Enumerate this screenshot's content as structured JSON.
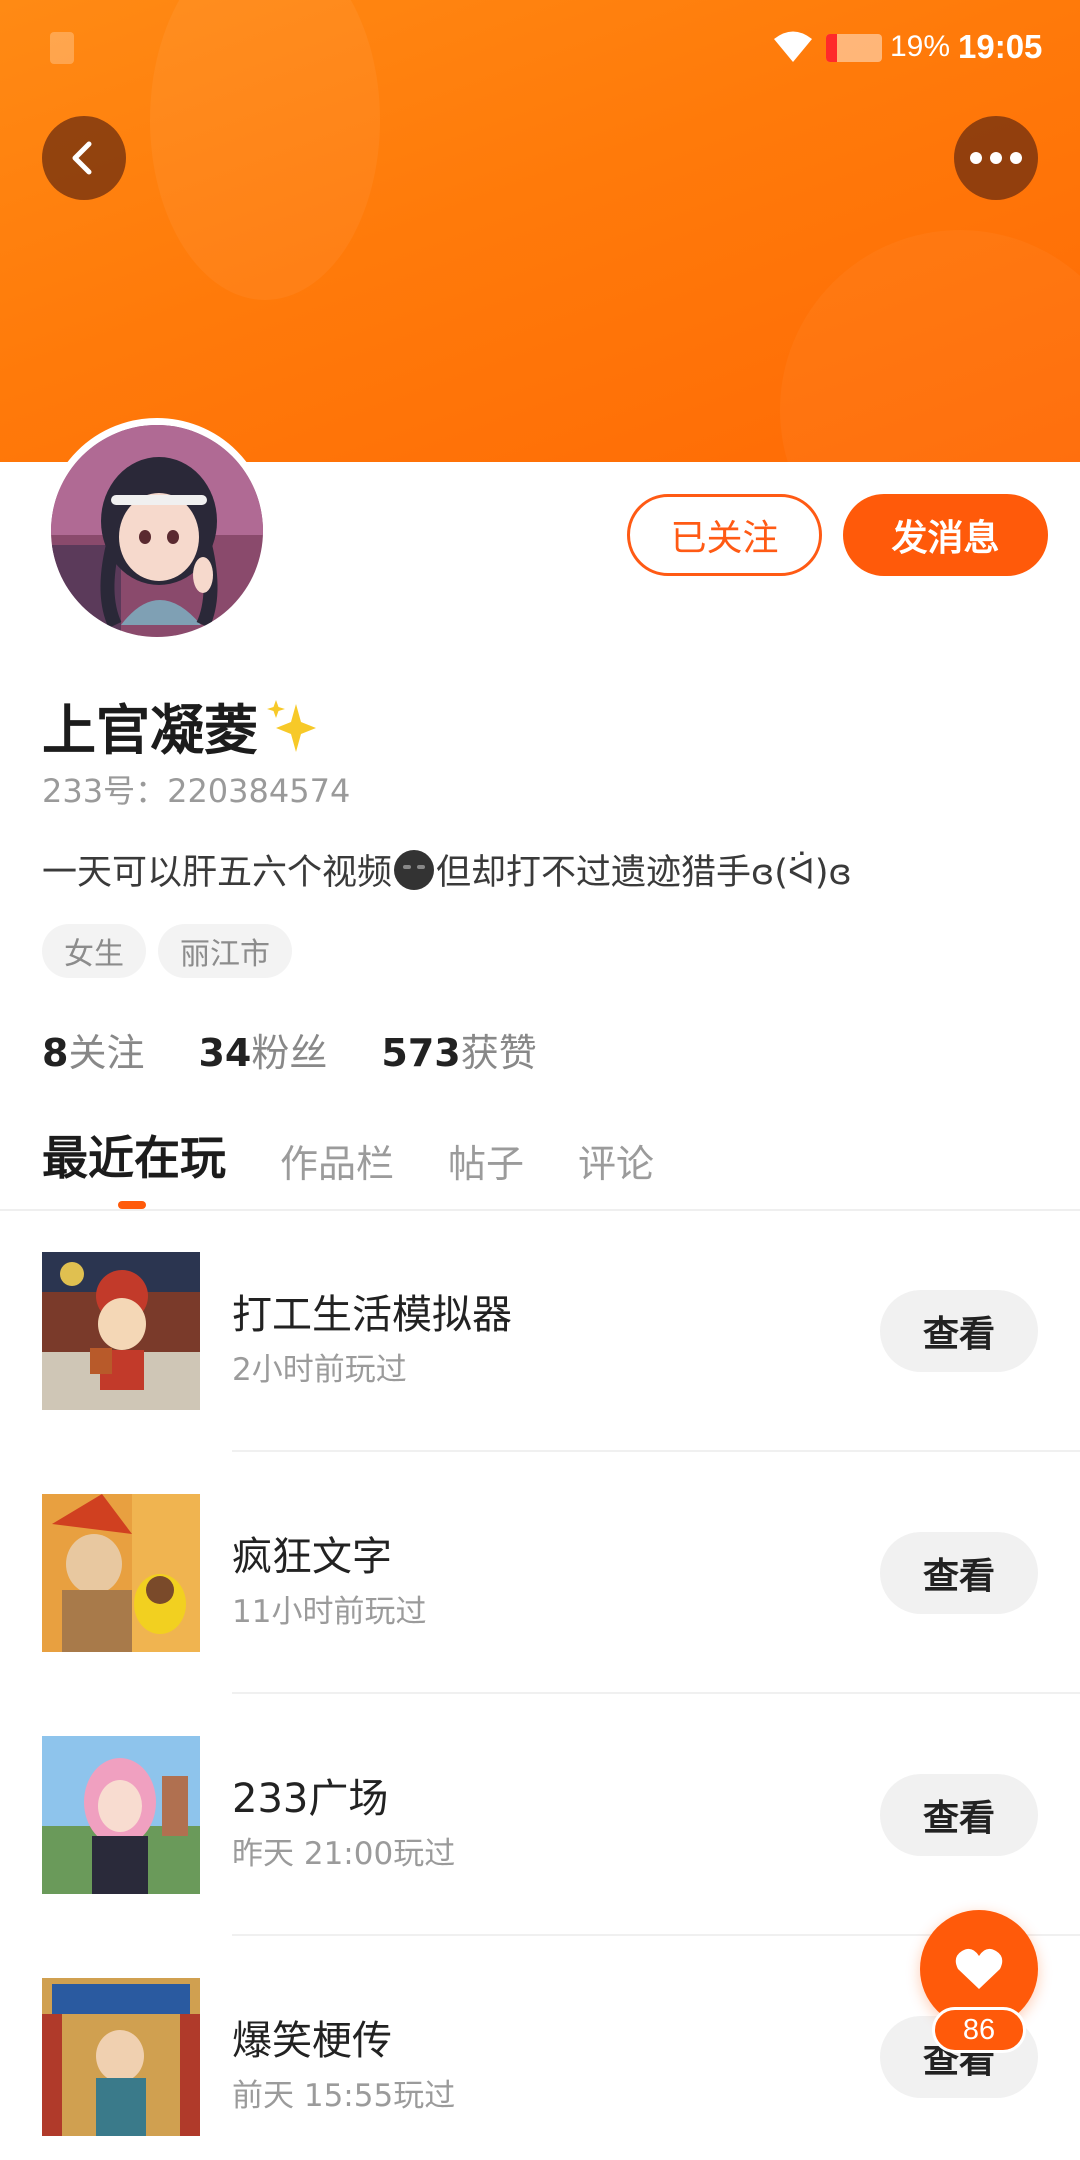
{
  "status_bar": {
    "battery_percent": "19%",
    "battery_level": 0.19,
    "time": "19:05"
  },
  "profile": {
    "name": "上官凝菱",
    "id_text": "233号：220384574",
    "bio_before": "一天可以肝五六个视频",
    "bio_after": "但却打不过遗迹猎手ɞ(ᐛ)ɞ",
    "tags": [
      "女生",
      "丽江市"
    ]
  },
  "actions": {
    "follow_label": "已关注",
    "message_label": "发消息"
  },
  "stats": {
    "following_count": "8",
    "following_label": "关注",
    "fans_count": "34",
    "fans_label": "粉丝",
    "likes_count": "573",
    "likes_label": "获赞"
  },
  "tabs": [
    "最近在玩",
    "作品栏",
    "帖子",
    "评论"
  ],
  "games": [
    {
      "title": "打工生活模拟器",
      "played": "2小时前玩过",
      "button": "查看"
    },
    {
      "title": "疯狂文字",
      "played": "11小时前玩过",
      "button": "查看"
    },
    {
      "title": "233广场",
      "played": "昨天 21:00玩过",
      "button": "查看"
    },
    {
      "title": "爆笑梗传",
      "played": "前天 15:55玩过",
      "button": "查看"
    }
  ],
  "like_fab": {
    "count": "86"
  },
  "colors": {
    "accent": "#ff5a0a",
    "header": "#ff7a0a",
    "muted_text": "#9b9b9b"
  }
}
